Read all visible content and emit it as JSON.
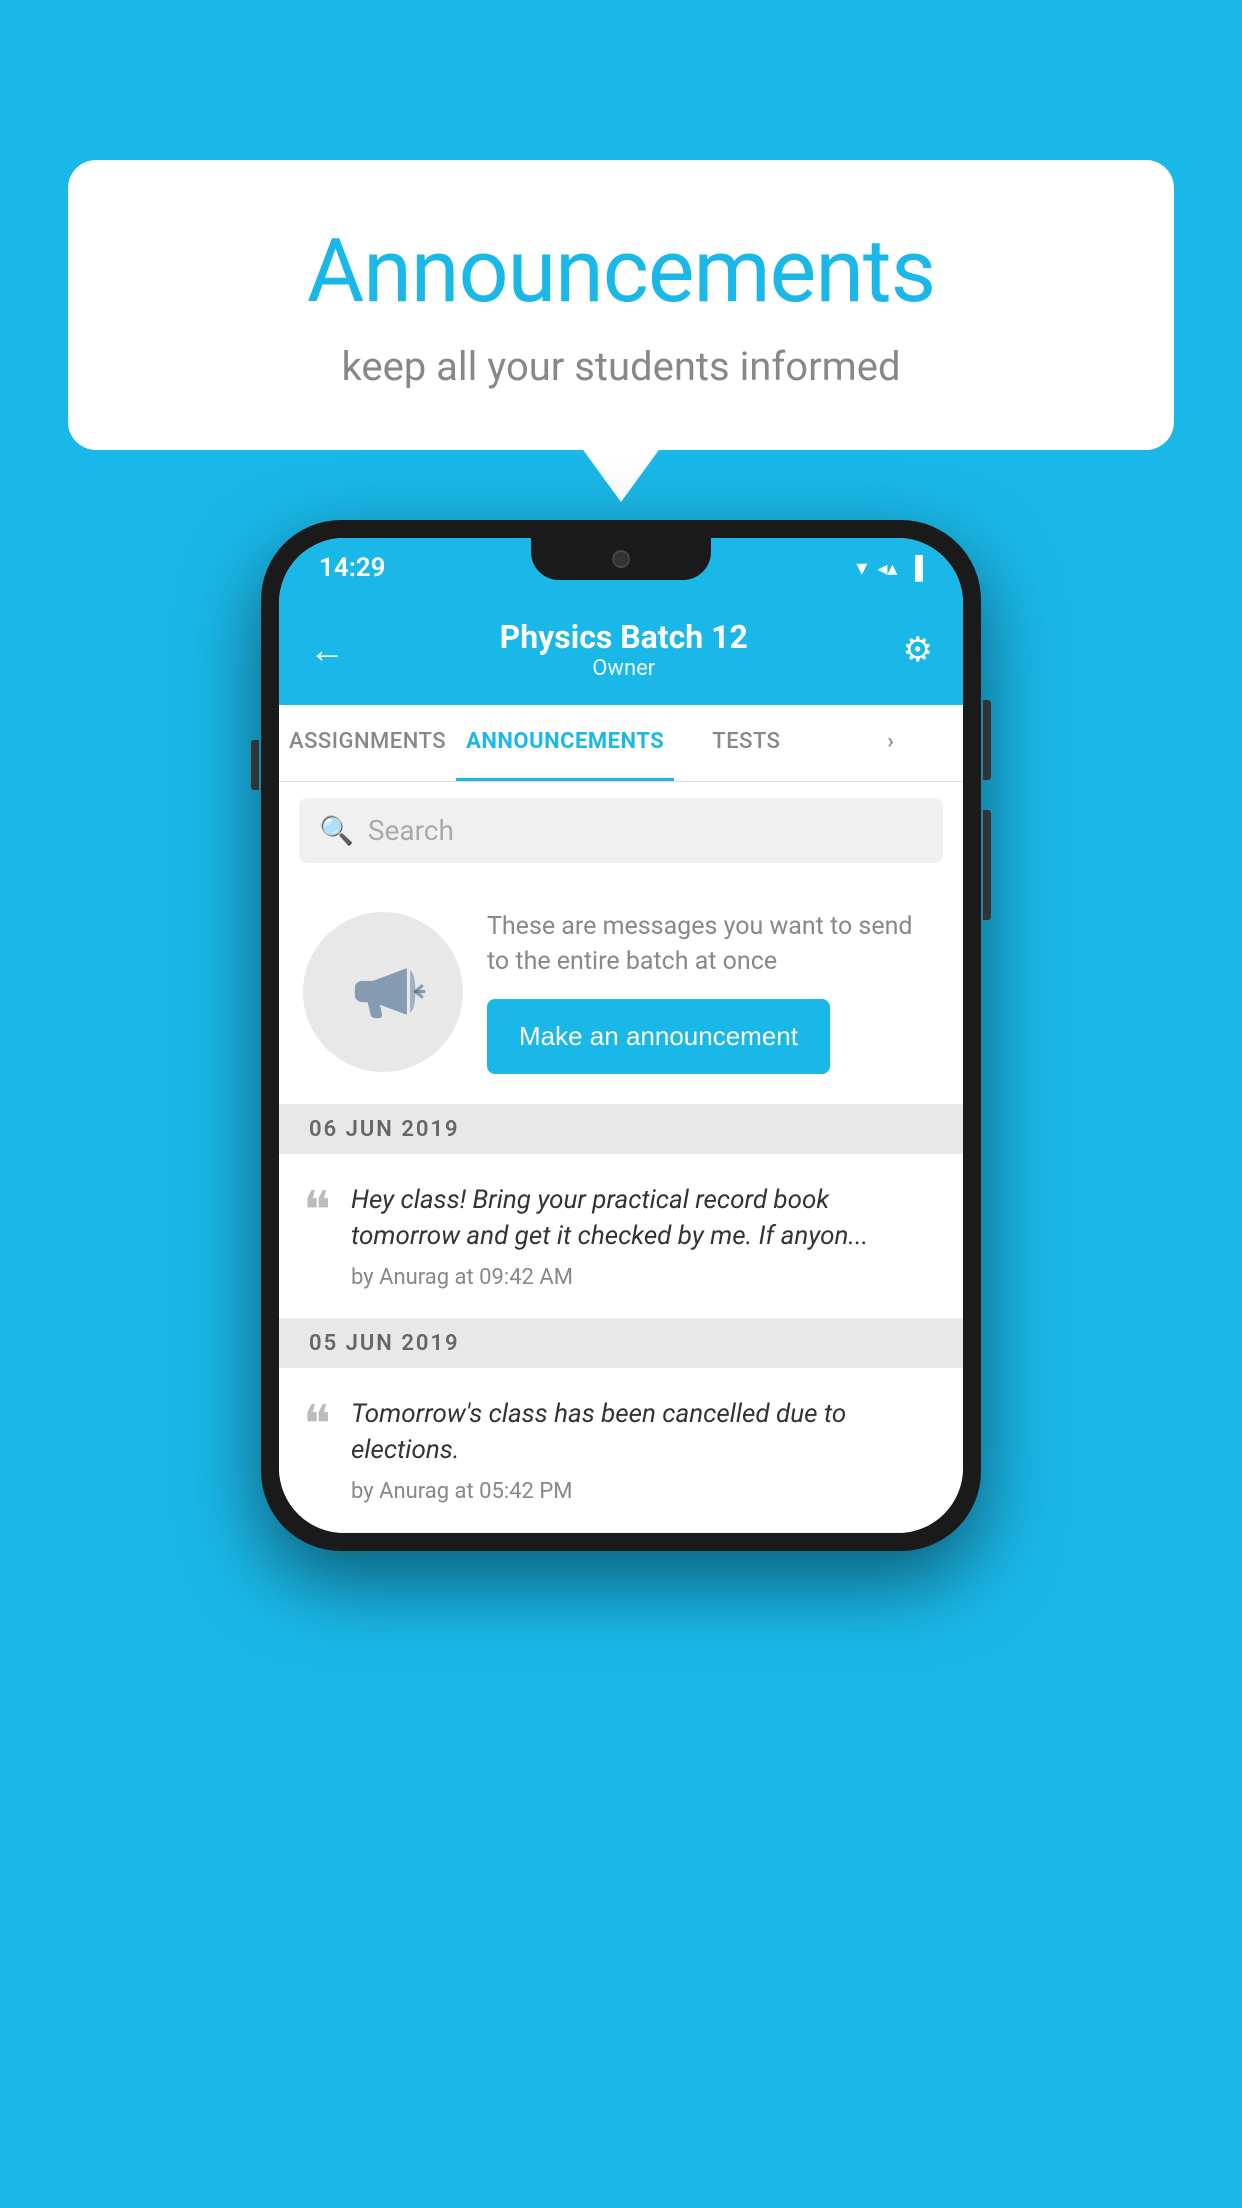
{
  "bubble": {
    "title": "Announcements",
    "subtitle": "keep all your students informed"
  },
  "phone": {
    "statusBar": {
      "time": "14:29"
    },
    "header": {
      "title": "Physics Batch 12",
      "subtitle": "Owner",
      "backLabel": "←",
      "gearLabel": "⚙"
    },
    "tabs": [
      {
        "label": "ASSIGNMENTS",
        "active": false
      },
      {
        "label": "ANNOUNCEMENTS",
        "active": true
      },
      {
        "label": "TESTS",
        "active": false
      },
      {
        "label": "›",
        "active": false
      }
    ],
    "search": {
      "placeholder": "Search"
    },
    "promo": {
      "text": "These are messages you want to send to the entire batch at once",
      "buttonLabel": "Make an announcement"
    },
    "announcements": [
      {
        "date": "06  JUN  2019",
        "text": "Hey class! Bring your practical record book tomorrow and get it checked by me. If anyon...",
        "meta": "by Anurag at 09:42 AM"
      },
      {
        "date": "05  JUN  2019",
        "text": "Tomorrow's class has been cancelled due to elections.",
        "meta": "by Anurag at 05:42 PM"
      }
    ]
  }
}
